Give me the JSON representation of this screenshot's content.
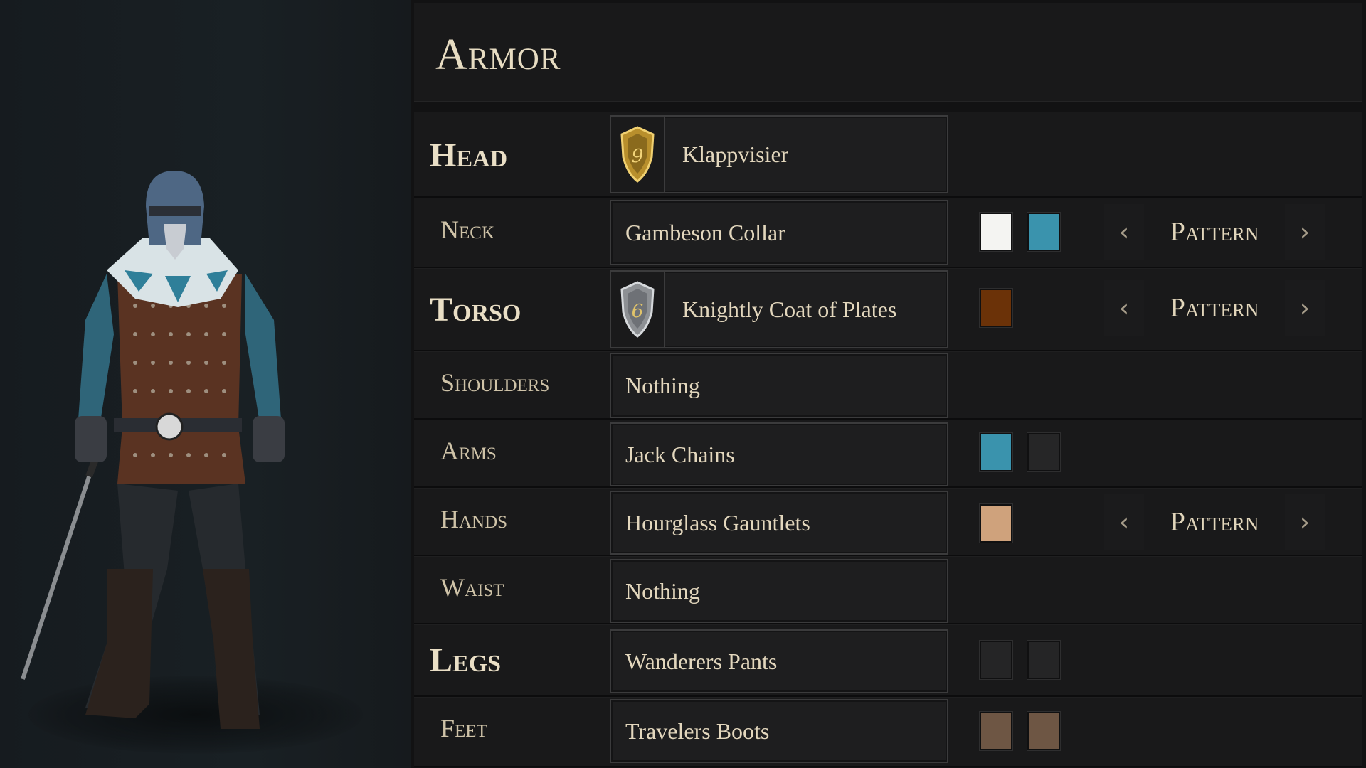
{
  "title": "Armor",
  "slots": {
    "head": {
      "label": "Head",
      "item": "Klappvisier",
      "tier": "9",
      "colors": []
    },
    "neck": {
      "label": "Neck",
      "item": "Gambeson Collar",
      "colors": [
        "#f4f4f2",
        "#3a93ad"
      ],
      "pattern": "Pattern"
    },
    "torso": {
      "label": "Torso",
      "item": "Knightly Coat of Plates",
      "tier": "6",
      "colors": [
        "#6b3208"
      ],
      "pattern": "Pattern"
    },
    "shoulders": {
      "label": "Shoulders",
      "item": "Nothing",
      "colors": []
    },
    "arms": {
      "label": "Arms",
      "item": "Jack Chains",
      "colors": [
        "#3a93ad",
        "#262627"
      ]
    },
    "hands": {
      "label": "Hands",
      "item": "Hourglass Gauntlets",
      "colors": [
        "#cfa27c"
      ],
      "pattern": "Pattern"
    },
    "waist": {
      "label": "Waist",
      "item": "Nothing",
      "colors": []
    },
    "legs": {
      "label": "Legs",
      "item": "Wanderers Pants",
      "colors": [
        "#252526",
        "#252526"
      ]
    },
    "feet": {
      "label": "Feet",
      "item": "Travelers Boots",
      "colors": [
        "#6e5644",
        "#6e5644"
      ]
    }
  },
  "pattern_arrows": {
    "prev": "‹",
    "next": "›"
  },
  "icons": {
    "gold_shield": "shield-icon",
    "silver_shield": "shield-icon",
    "prev": "chevron-left-icon",
    "next": "chevron-right-icon"
  },
  "theme": {
    "gold": "#c9a23b",
    "silver": "#b9bcc0",
    "text": "#e8dcc4"
  }
}
